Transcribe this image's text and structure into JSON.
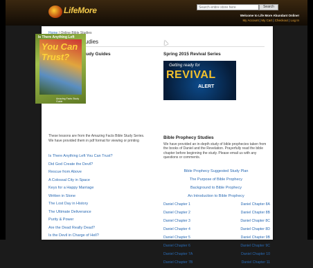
{
  "header": {
    "logo_text": "LifeMore",
    "logo_sub": "",
    "search_placeholder": "Search entire store here",
    "search_button": "Search",
    "welcome": "Welcome to Life More Abundant Online!",
    "links": [
      "My Account",
      "My Cart",
      "Checkout",
      "Log In"
    ]
  },
  "breadcrumb": {
    "home": "Home",
    "separator": "/",
    "current": "Online Bible Studies"
  },
  "page_title": "Online Bible Studies",
  "left": {
    "heading": "Amazing Facts Study Guides",
    "book_cover": {
      "top": "Is There Anything Left",
      "you": "You Can Trust?",
      "foot": "Amazing Facts Study Guide"
    },
    "intro": "These lessons are from the Amazing Facts Bible Study Series. We have provided them in pdf format for viewing or printing",
    "studies": [
      "Is There Anything Left You Can Trust?",
      "Did God Create the Devil?",
      "Rescue from Above",
      "A Colossal City in Space",
      "Keys for a Happy Marriage",
      "Written in Stone",
      "The Lost Day in History",
      "The Ultimate Deliverance",
      "Purity & Power",
      "Are the Dead Really Dead?",
      "Is the Devil in Charge of Hell?"
    ]
  },
  "right": {
    "heading": "Spring 2015 Revival Series",
    "revival_banner": {
      "small": "Getting ready for",
      "big": "REVIVAL",
      "alert": "ALERT"
    },
    "prophecy_title": "Bible Prophecy Studies",
    "prophecy_desc": "We have provided an in-depth study of bible prophecies taken from the books of Daniel and the Revelation. Prayerfully read the bible chapter before beginning the study. Please email us with any questions or comments.",
    "prophecy_links": [
      "Bible Prophecy Suggested Study Plan",
      "The Purpose of Bible Prophecy",
      "Background to Bible Prophecy",
      "An Introduction to Bible Prophecy"
    ],
    "chapters": [
      [
        "Daniel Chapter 1",
        "Daniel Chapter 8A"
      ],
      [
        "Daniel Chapter 2",
        "Daniel Chapter 8B"
      ],
      [
        "Daniel Chapter 3",
        "Daniel Chapter 8C"
      ],
      [
        "Daniel Chapter 4",
        "Daniel Chapter 8D"
      ],
      [
        "Daniel Chapter 5",
        "Daniel Chapter 9B"
      ],
      [
        "Daniel Chapter 6",
        "Daniel Chapter 9C"
      ],
      [
        "Daniel Chapter 7A",
        "Daniel Chapter 10"
      ],
      [
        "Daniel Chapter 7B",
        "Daniel Chapter 11"
      ]
    ]
  }
}
